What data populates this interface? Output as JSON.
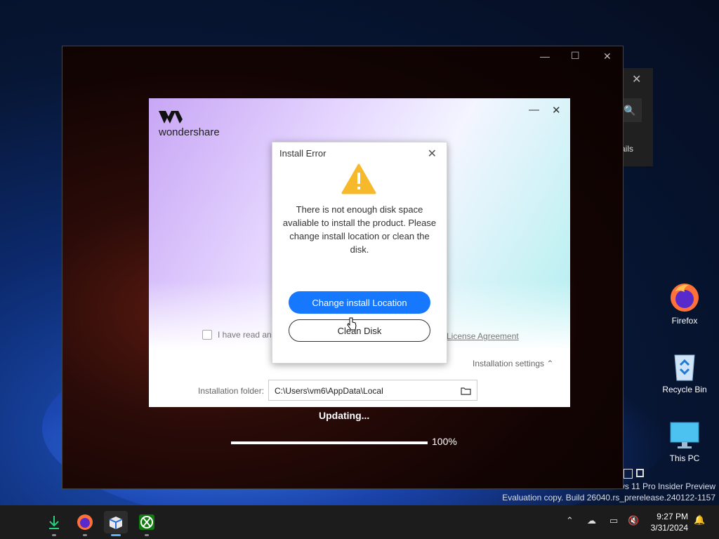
{
  "desktop": {
    "icons": [
      {
        "label": "Firefox"
      },
      {
        "label": "Recycle Bin"
      },
      {
        "label": "This PC"
      }
    ],
    "watermark_line1": "ws 11 Pro Insider Preview",
    "watermark_line2": "Evaluation copy. Build 26040.rs_prerelease.240122-1157"
  },
  "behind_window": {
    "partial_text": "ails"
  },
  "main_window": {
    "status_text": "Updating...",
    "progress_percent_label": "100%",
    "progress_value": 1.0
  },
  "installer": {
    "brand_name": "wondershare",
    "agree_text": "I have read and",
    "license_link": "License Agreement",
    "installation_settings": "Installation settings",
    "installation_folder_label": "Installation folder:",
    "installation_folder_value": "C:\\Users\\vm6\\AppData\\Local"
  },
  "error_dialog": {
    "title": "Install Error",
    "message": "There is not enough disk space avaliable to install the product. Please change install location or clean the disk.",
    "primary_button": "Change install Location",
    "secondary_button": "Clean Disk"
  },
  "taskbar": {
    "apps": [
      "download-icon",
      "firefox-icon",
      "installer-icon",
      "xbox-icon"
    ],
    "clock_time": "9:27 PM",
    "clock_date": "3/31/2024"
  },
  "colors": {
    "accent_blue": "#1677ff",
    "warning_yellow": "#f6b92b"
  }
}
